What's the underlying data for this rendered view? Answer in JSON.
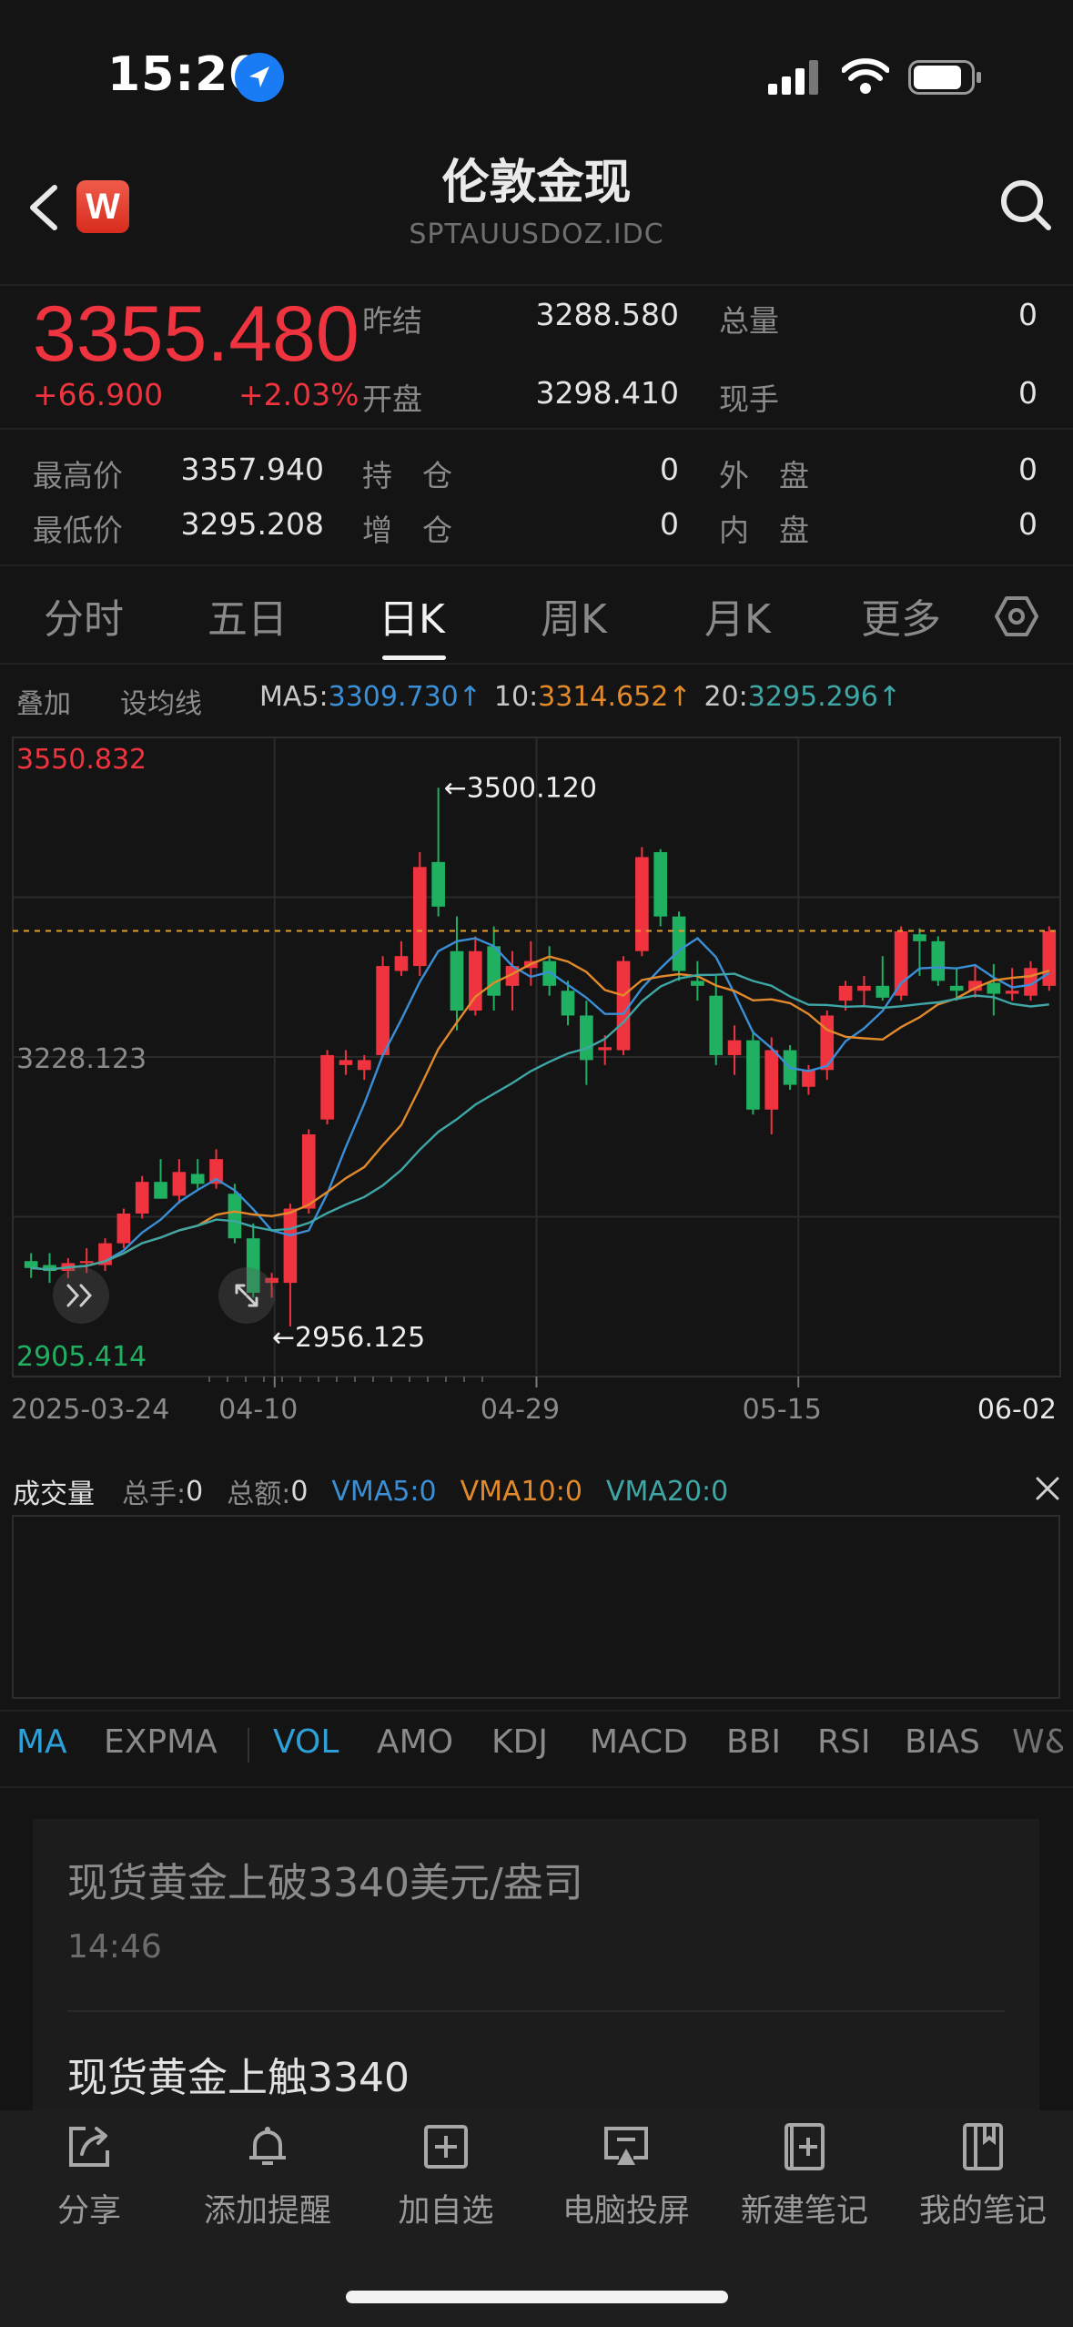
{
  "status_bar": {
    "time": "15:20"
  },
  "header": {
    "title": "伦敦金现",
    "subtitle": "SPTAUUSDOZ.IDC",
    "brand_badge": "W"
  },
  "quote": {
    "price": "3355.480",
    "change": "+66.900",
    "change_pct": "+2.03%",
    "prev_settle_label": "昨结",
    "prev_settle": "3288.580",
    "open_label": "开盘",
    "open": "3298.410",
    "total_vol_label": "总量",
    "total_vol": "0",
    "current_vol_label": "现手",
    "current_vol": "0",
    "high_label": "最高价",
    "high": "3357.940",
    "low_label": "最低价",
    "low": "3295.208",
    "position_label": "持　仓",
    "position": "0",
    "add_position_label": "增　仓",
    "add_position": "0",
    "outer_label": "外　盘",
    "outer": "0",
    "inner_label": "内　盘",
    "inner": "0"
  },
  "tabs": [
    "分时",
    "五日",
    "日K",
    "周K",
    "月K",
    "更多"
  ],
  "active_tab": "日K",
  "ma_bar": {
    "overlay": "叠加",
    "set_ma": "设均线",
    "ma5_label": "MA5:",
    "ma5_value": "3309.730↑",
    "ma10_label": "10:",
    "ma10_value": "3314.652↑",
    "ma20_label": "20:",
    "ma20_value": "3295.296↑"
  },
  "colors": {
    "up": "#f0343f",
    "down": "#1fb061",
    "ma5": "#3a8fd6",
    "ma10": "#e28a2b",
    "ma20": "#3fa6a6"
  },
  "chart_data": {
    "type": "candlestick",
    "y_top_label": "3550.832",
    "y_mid_label": "3228.123",
    "y_bottom_label": "2905.414",
    "ylim": [
      2905.414,
      3550.832
    ],
    "max_annotation": "3500.120",
    "min_annotation": "2956.125",
    "last_close": 3355.48,
    "x_ticks": [
      "2025-03-24",
      "04-10",
      "04-29",
      "05-15",
      "06-02"
    ],
    "candles": [
      {
        "o": 3022,
        "h": 3030,
        "l": 3005,
        "c": 3015
      },
      {
        "o": 3018,
        "h": 3030,
        "l": 3000,
        "c": 3012
      },
      {
        "o": 3012,
        "h": 3025,
        "l": 3005,
        "c": 3020
      },
      {
        "o": 3020,
        "h": 3035,
        "l": 3010,
        "c": 3022
      },
      {
        "o": 3018,
        "h": 3045,
        "l": 3012,
        "c": 3040
      },
      {
        "o": 3040,
        "h": 3075,
        "l": 3035,
        "c": 3070
      },
      {
        "o": 3070,
        "h": 3108,
        "l": 3065,
        "c": 3102
      },
      {
        "o": 3102,
        "h": 3125,
        "l": 3085,
        "c": 3085
      },
      {
        "o": 3088,
        "h": 3125,
        "l": 3080,
        "c": 3112
      },
      {
        "o": 3110,
        "h": 3125,
        "l": 3095,
        "c": 3100
      },
      {
        "o": 3100,
        "h": 3135,
        "l": 3095,
        "c": 3125
      },
      {
        "o": 3090,
        "h": 3100,
        "l": 3040,
        "c": 3045
      },
      {
        "o": 3045,
        "h": 3060,
        "l": 2985,
        "c": 2990
      },
      {
        "o": 3000,
        "h": 3010,
        "l": 2985,
        "c": 3005
      },
      {
        "o": 3000,
        "h": 3080,
        "l": 2956,
        "c": 3075
      },
      {
        "o": 3075,
        "h": 3155,
        "l": 3070,
        "c": 3150
      },
      {
        "o": 3165,
        "h": 3235,
        "l": 3160,
        "c": 3230
      },
      {
        "o": 3220,
        "h": 3235,
        "l": 3210,
        "c": 3225
      },
      {
        "o": 3215,
        "h": 3230,
        "l": 3205,
        "c": 3225
      },
      {
        "o": 3230,
        "h": 3330,
        "l": 3228,
        "c": 3320
      },
      {
        "o": 3315,
        "h": 3345,
        "l": 3310,
        "c": 3330
      },
      {
        "o": 3320,
        "h": 3435,
        "l": 3310,
        "c": 3420
      },
      {
        "o": 3425,
        "h": 3500,
        "l": 3370,
        "c": 3380
      },
      {
        "o": 3335,
        "h": 3370,
        "l": 3255,
        "c": 3275
      },
      {
        "o": 3275,
        "h": 3350,
        "l": 3270,
        "c": 3335
      },
      {
        "o": 3340,
        "h": 3360,
        "l": 3275,
        "c": 3290
      },
      {
        "o": 3300,
        "h": 3335,
        "l": 3275,
        "c": 3320
      },
      {
        "o": 3318,
        "h": 3345,
        "l": 3300,
        "c": 3325
      },
      {
        "o": 3325,
        "h": 3340,
        "l": 3290,
        "c": 3300
      },
      {
        "o": 3295,
        "h": 3305,
        "l": 3260,
        "c": 3270
      },
      {
        "o": 3270,
        "h": 3285,
        "l": 3200,
        "c": 3225
      },
      {
        "o": 3235,
        "h": 3250,
        "l": 3220,
        "c": 3238
      },
      {
        "o": 3235,
        "h": 3330,
        "l": 3230,
        "c": 3325
      },
      {
        "o": 3335,
        "h": 3440,
        "l": 3330,
        "c": 3430
      },
      {
        "o": 3435,
        "h": 3438,
        "l": 3360,
        "c": 3370
      },
      {
        "o": 3370,
        "h": 3375,
        "l": 3305,
        "c": 3315
      },
      {
        "o": 3305,
        "h": 3325,
        "l": 3285,
        "c": 3300
      },
      {
        "o": 3290,
        "h": 3310,
        "l": 3220,
        "c": 3230
      },
      {
        "o": 3230,
        "h": 3260,
        "l": 3210,
        "c": 3245
      },
      {
        "o": 3245,
        "h": 3255,
        "l": 3170,
        "c": 3175
      },
      {
        "o": 3175,
        "h": 3248,
        "l": 3150,
        "c": 3235
      },
      {
        "o": 3235,
        "h": 3240,
        "l": 3195,
        "c": 3200
      },
      {
        "o": 3198,
        "h": 3220,
        "l": 3190,
        "c": 3215
      },
      {
        "o": 3215,
        "h": 3275,
        "l": 3205,
        "c": 3270
      },
      {
        "o": 3285,
        "h": 3305,
        "l": 3275,
        "c": 3300
      },
      {
        "o": 3295,
        "h": 3310,
        "l": 3280,
        "c": 3300
      },
      {
        "o": 3300,
        "h": 3330,
        "l": 3285,
        "c": 3288
      },
      {
        "o": 3290,
        "h": 3360,
        "l": 3285,
        "c": 3355
      },
      {
        "o": 3352,
        "h": 3358,
        "l": 3310,
        "c": 3345
      },
      {
        "o": 3345,
        "h": 3350,
        "l": 3300,
        "c": 3305
      },
      {
        "o": 3300,
        "h": 3318,
        "l": 3285,
        "c": 3295
      },
      {
        "o": 3295,
        "h": 3320,
        "l": 3288,
        "c": 3305
      },
      {
        "o": 3303,
        "h": 3322,
        "l": 3270,
        "c": 3292
      },
      {
        "o": 3292,
        "h": 3318,
        "l": 3285,
        "c": 3295
      },
      {
        "o": 3290,
        "h": 3325,
        "l": 3285,
        "c": 3318
      },
      {
        "o": 3300,
        "h": 3360,
        "l": 3295,
        "c": 3355
      }
    ]
  },
  "volume": {
    "title": "成交量",
    "total_hand_label": "总手:",
    "total_hand": "0",
    "total_amount_label": "总额:",
    "total_amount": "0",
    "vma5": "VMA5:0",
    "vma10": "VMA10:0",
    "vma20": "VMA20:0"
  },
  "indicator_tabs": [
    "MA",
    "EXPMA",
    "VOL",
    "AMO",
    "KDJ",
    "MACD",
    "BBI",
    "RSI",
    "BIAS",
    "W&"
  ],
  "news": [
    {
      "title": "现货黄金上破3340美元/盎司",
      "time": "14:46"
    },
    {
      "title": "现货黄金上触3340"
    }
  ],
  "bottom_nav": [
    {
      "label": "分享",
      "icon": "share-icon"
    },
    {
      "label": "添加提醒",
      "icon": "bell-icon"
    },
    {
      "label": "加自选",
      "icon": "add-watchlist-icon"
    },
    {
      "label": "电脑投屏",
      "icon": "screen-cast-icon"
    },
    {
      "label": "新建笔记",
      "icon": "new-note-icon"
    },
    {
      "label": "我的笔记",
      "icon": "notebook-icon"
    }
  ]
}
